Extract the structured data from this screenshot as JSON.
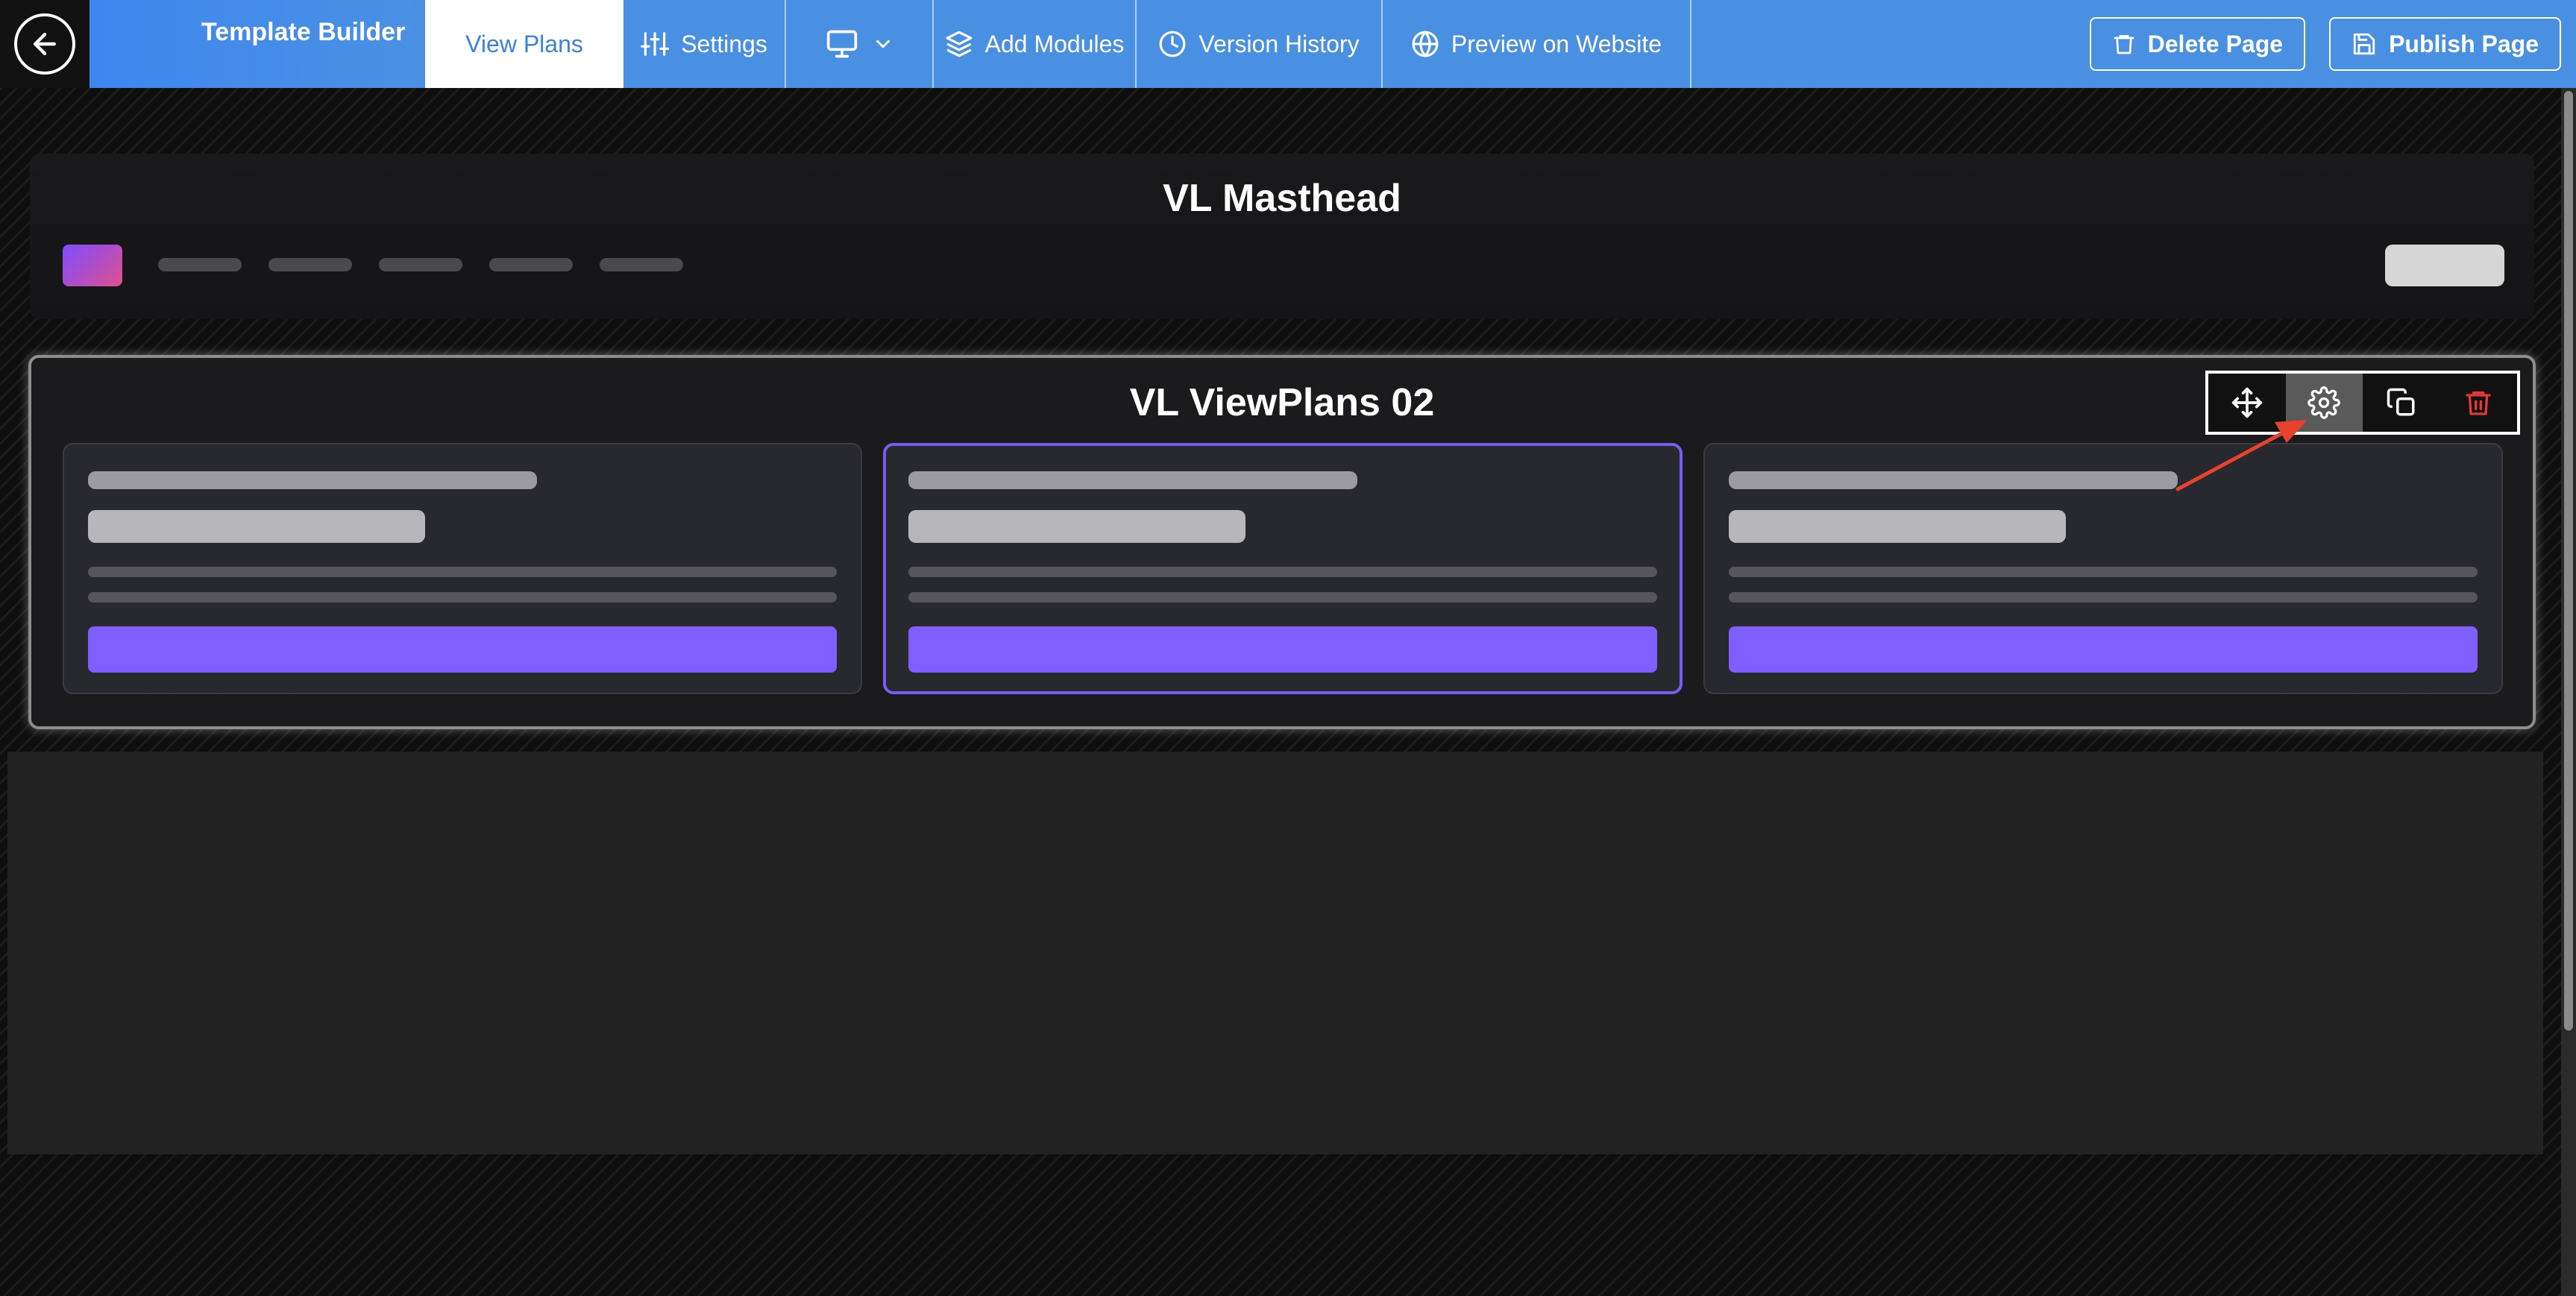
{
  "header": {
    "back_icon": "arrow-left-icon",
    "title": "Template Builder",
    "tabs": [
      {
        "label": "View Plans",
        "icon": "",
        "active": true
      },
      {
        "label": "Settings",
        "icon": "sliders-icon"
      },
      {
        "label": "",
        "icon": "monitor-icon",
        "dropdown_icon": "chevron-down-icon"
      },
      {
        "label": "Add Modules",
        "icon": "layers-icon"
      },
      {
        "label": "Version History",
        "icon": "clock-icon"
      },
      {
        "label": "Preview on Website",
        "icon": "globe-icon"
      }
    ],
    "delete_label": "Delete Page",
    "publish_label": "Publish Page"
  },
  "canvas": {
    "masthead": {
      "title": "VL Masthead",
      "nav_placeholders": 5
    },
    "viewplans": {
      "title": "VL ViewPlans 02",
      "cards": 3,
      "selected_card": 2,
      "toolbar": [
        "move-icon",
        "gear-icon",
        "duplicate-icon",
        "trash-icon"
      ],
      "active_tool": "gear-icon"
    }
  },
  "colors": {
    "header_blue": "#4a90e2",
    "accent_purple": "#7f5fff",
    "delete_red": "#e53935",
    "annotation_arrow": "#e8412c"
  }
}
